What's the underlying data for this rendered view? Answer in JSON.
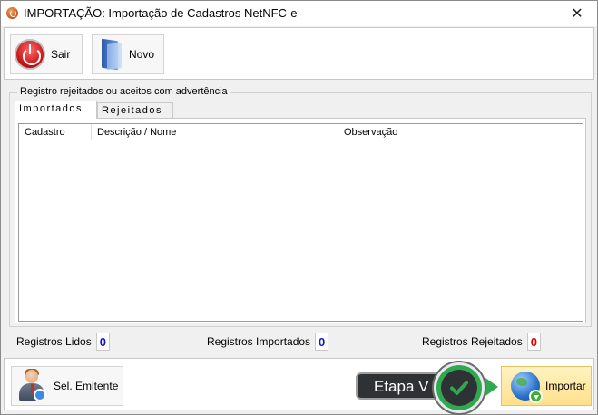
{
  "window": {
    "title": "IMPORTAÇÃO: Importação de Cadastros NetNFC-e",
    "close_glyph": "✕"
  },
  "toolbar": {
    "sair_label": "Sair",
    "novo_label": "Novo"
  },
  "group": {
    "legend": "Registro rejeitados ou aceitos com advertência"
  },
  "tabs": [
    {
      "label": "Importados",
      "active": true
    },
    {
      "label": "Rejeitados",
      "active": false
    }
  ],
  "grid": {
    "columns": [
      "Cadastro",
      "Descrição / Nome",
      "Observação"
    ],
    "rows": []
  },
  "counters": {
    "lidos": {
      "label": "Registros Lidos",
      "value": "0"
    },
    "importados": {
      "label": "Registros Importados",
      "value": "0"
    },
    "rejeitados": {
      "label": "Registros Rejeitados",
      "value": "0"
    }
  },
  "bottom": {
    "emitente_label": "Sel. Emitente",
    "importar_label": "Importar"
  },
  "annotation": {
    "etapa_label": "Etapa V"
  },
  "icons": {
    "app": "app-icon",
    "sair": "power-icon",
    "novo": "folder-icon",
    "emitente": "user-icon",
    "importar": "globe-download-icon",
    "etapa": "checkmark-icon"
  },
  "colors": {
    "count_blue": "#1414c8",
    "count_red": "#e00000",
    "importar_bg": "#ffe08a",
    "etapa_green": "#2fa84f",
    "etapa_dark": "#2f3235"
  }
}
